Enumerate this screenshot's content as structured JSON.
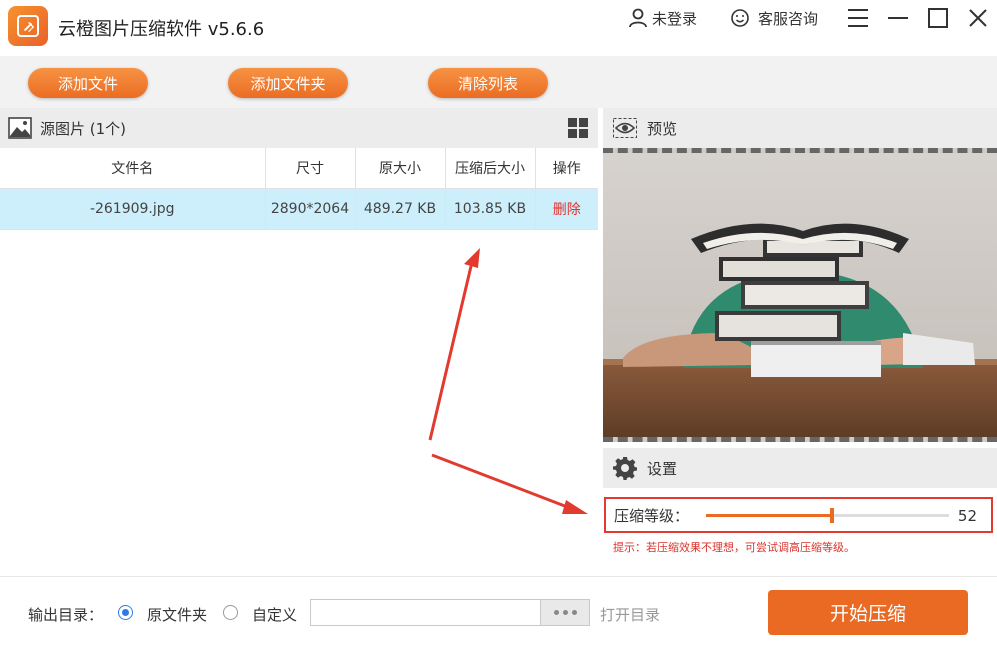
{
  "app": {
    "title": "云橙图片压缩软件 v5.6.6"
  },
  "titlebar": {
    "login": "未登录",
    "support": "客服咨询"
  },
  "toolbar": {
    "add_file": "添加文件",
    "add_folder": "添加文件夹",
    "clear_list": "清除列表"
  },
  "source": {
    "header": "源图片 (1个)"
  },
  "table": {
    "columns": [
      "文件名",
      "尺寸",
      "原大小",
      "压缩后大小",
      "操作"
    ],
    "rows": [
      {
        "name": "-261909.jpg",
        "size": "2890*2064",
        "original": "489.27 KB",
        "compressed": "103.85 KB",
        "action": "删除"
      }
    ]
  },
  "preview": {
    "header": "预览"
  },
  "settings": {
    "header": "设置",
    "level_label": "压缩等级：",
    "level_value": "52",
    "level_fraction": 0.52,
    "tip": "提示：若压缩效果不理想，可尝试调高压缩等级。"
  },
  "bottom": {
    "output_label": "输出目录：",
    "option_original": "原文件夹",
    "option_custom": "自定义",
    "path_value": "",
    "open_dir": "打开目录",
    "start": "开始压缩"
  },
  "colors": {
    "accent": "#ea6c22",
    "highlight_row": "#cdeefb",
    "annotation": "#e23a2f",
    "radio": "#2b7de1"
  },
  "icons": [
    "app-logo-icon",
    "user-icon",
    "smile-icon",
    "menu-icon",
    "minimize-icon",
    "maximize-icon",
    "close-icon",
    "image-icon",
    "grid-view-icon",
    "eye-icon",
    "gear-icon"
  ]
}
